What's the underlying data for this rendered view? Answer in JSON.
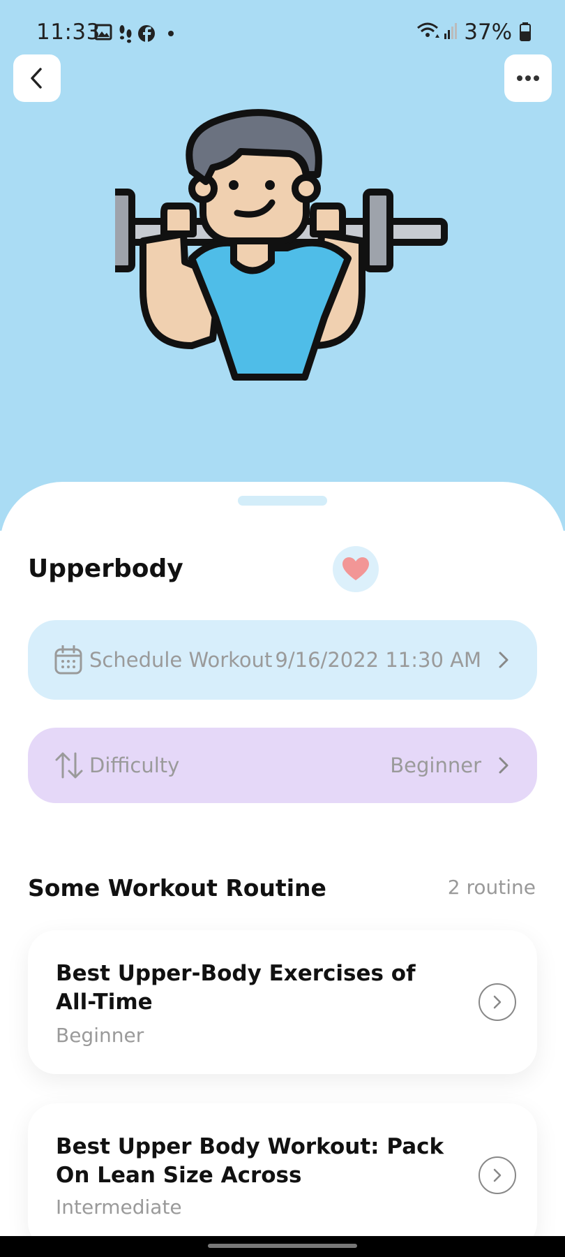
{
  "status_bar": {
    "time": "11:33",
    "battery": "37%",
    "icons": [
      "image-icon",
      "steps-icon",
      "facebook-icon",
      "dot-icon",
      "wifi-icon",
      "signal-icon",
      "battery-icon"
    ]
  },
  "header": {
    "back_icon": "chevron-left-icon",
    "menu_icon": "more-dots-icon",
    "illustration": "weightlifter-illustration"
  },
  "workout": {
    "title": "Upperbody",
    "favorite_icon": "heart-icon",
    "schedule": {
      "label": "Schedule Workout",
      "value": "9/16/2022 11:30 AM",
      "icon": "calendar-icon"
    },
    "difficulty": {
      "label": "Difficulty",
      "value": "Beginner",
      "icon": "sort-arrows-icon"
    }
  },
  "routines": {
    "title": "Some Workout Routine",
    "count": "2 routine",
    "items": [
      {
        "title": "Best Upper-Body Exercises of All-Time",
        "level": "Beginner"
      },
      {
        "title": "Best Upper Body Workout: Pack On Lean Size Across",
        "level": "Intermediate"
      }
    ]
  },
  "colors": {
    "hero_bg": "#aadcf4",
    "schedule_bg": "#d7eefb",
    "difficulty_bg": "#e5d8f8",
    "heart": "#f29696",
    "shirt": "#4fbde8"
  }
}
